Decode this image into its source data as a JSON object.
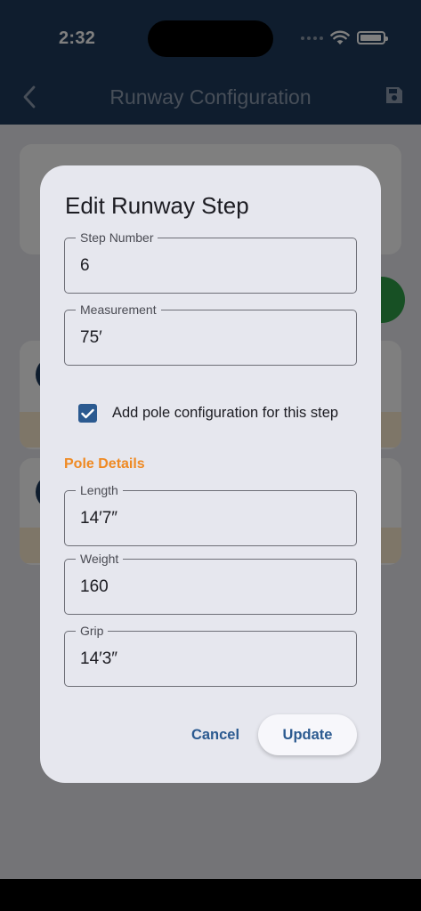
{
  "status_bar": {
    "time": "2:32",
    "icons": [
      "signal-dots-icon",
      "wifi-icon",
      "battery-icon"
    ]
  },
  "app_bar": {
    "title": "Runway Configuration",
    "back_icon": "chevron-left-icon",
    "save_icon": "floppy-disk-icon"
  },
  "dialog": {
    "title": "Edit Runway Step",
    "fields": {
      "step_number": {
        "label": "Step Number",
        "value": "6"
      },
      "measurement": {
        "label": "Measurement",
        "value": "75′"
      }
    },
    "pole_checkbox": {
      "label": "Add pole configuration for this step",
      "checked": true
    },
    "pole_section": {
      "title": "Pole Details",
      "length": {
        "label": "Length",
        "value": "14′7″"
      },
      "weight": {
        "label": "Weight",
        "value": "160"
      },
      "grip": {
        "label": "Grip",
        "value": "14′3″"
      }
    },
    "actions": {
      "cancel": "Cancel",
      "update": "Update"
    }
  },
  "colors": {
    "app_bar": "#1f3b5c",
    "dialog_bg": "#e6e7ee",
    "accent_blue": "#2b5a90",
    "section_orange": "#ef8a23",
    "fab_green": "#2fa148"
  }
}
